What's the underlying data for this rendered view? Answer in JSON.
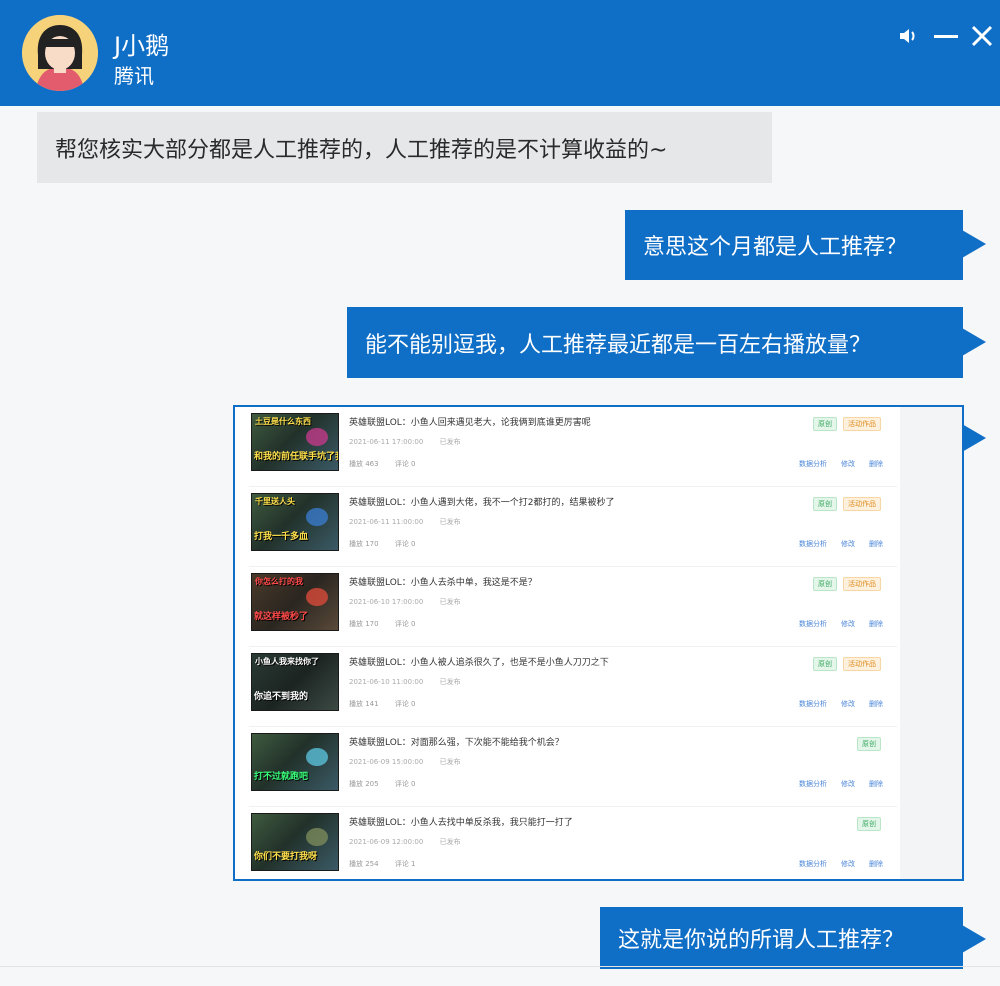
{
  "header": {
    "contact_name": "J小鹅",
    "organization": "腾讯",
    "icons": [
      "speaker-icon",
      "minimize-icon",
      "close-icon"
    ]
  },
  "messages": [
    {
      "side": "incoming",
      "text": "帮您核实大部分都是人工推荐的，人工推荐的是不计算收益的~"
    },
    {
      "side": "outgoing",
      "text": "意思这个月都是人工推荐？"
    },
    {
      "side": "outgoing",
      "text": "能不能别逗我，人工推荐最近都是一百左右播放量？"
    },
    {
      "side": "outgoing",
      "text": "这就是你说的所谓人工推荐？"
    }
  ],
  "screenshot": {
    "videos": [
      {
        "thumb_top": "土豆是什么东西",
        "thumb_caption": "和我的前任联手坑了我",
        "title": "英雄联盟LOL：小鱼人回来遇见老大，论我俩到底谁更厉害呢",
        "date": "2021-06-11 17:00:00",
        "status": "已发布",
        "plays": "播放 463",
        "likes": "评论 0",
        "badges": [
          "原创",
          "活动作品"
        ],
        "actions": [
          "数据分析",
          "修改",
          "删除"
        ]
      },
      {
        "thumb_top": "千里送人头",
        "thumb_caption": "打我一千多血",
        "title": "英雄联盟LOL：小鱼人遇到大佬，我不一个打2都打的，结果被秒了",
        "date": "2021-06-11 11:00:00",
        "status": "已发布",
        "plays": "播放 170",
        "likes": "评论 0",
        "badges": [
          "原创",
          "活动作品"
        ],
        "actions": [
          "数据分析",
          "修改",
          "删除"
        ]
      },
      {
        "thumb_top": "你怎么打的我",
        "thumb_caption": "就这样被秒了",
        "title": "英雄联盟LOL：小鱼人去杀中单，我这是不是？",
        "date": "2021-06-10 17:00:00",
        "status": "已发布",
        "plays": "播放 170",
        "likes": "评论 0",
        "badges": [
          "原创",
          "活动作品"
        ],
        "actions": [
          "数据分析",
          "修改",
          "删除"
        ]
      },
      {
        "thumb_top": "小鱼人我来找你了",
        "thumb_caption": "你追不到我的",
        "title": "英雄联盟LOL：小鱼人被人追杀很久了，也是不是小鱼人刀刀之下",
        "date": "2021-06-10 11:00:00",
        "status": "已发布",
        "plays": "播放 141",
        "likes": "评论 0",
        "badges": [
          "原创",
          "活动作品"
        ],
        "actions": [
          "数据分析",
          "修改",
          "删除"
        ]
      },
      {
        "thumb_top": "",
        "thumb_caption": "打不过就跑吧",
        "title": "英雄联盟LOL：对面那么强，下次能不能给我个机会？",
        "date": "2021-06-09 15:00:00",
        "status": "已发布",
        "plays": "播放 205",
        "likes": "评论 0",
        "badges": [
          "原创"
        ],
        "actions": [
          "数据分析",
          "修改",
          "删除"
        ]
      },
      {
        "thumb_top": "",
        "thumb_caption": "你们不要打我呀",
        "title": "英雄联盟LOL：小鱼人去找中单反杀我，我只能打一打了",
        "date": "2021-06-09 12:00:00",
        "status": "已发布",
        "plays": "播放 254",
        "likes": "评论 1",
        "badges": [
          "原创"
        ],
        "actions": [
          "数据分析",
          "修改",
          "删除"
        ]
      }
    ]
  },
  "colors": {
    "brand_blue": "#0f6ec6",
    "incoming_bubble": "#e6e7e9"
  }
}
